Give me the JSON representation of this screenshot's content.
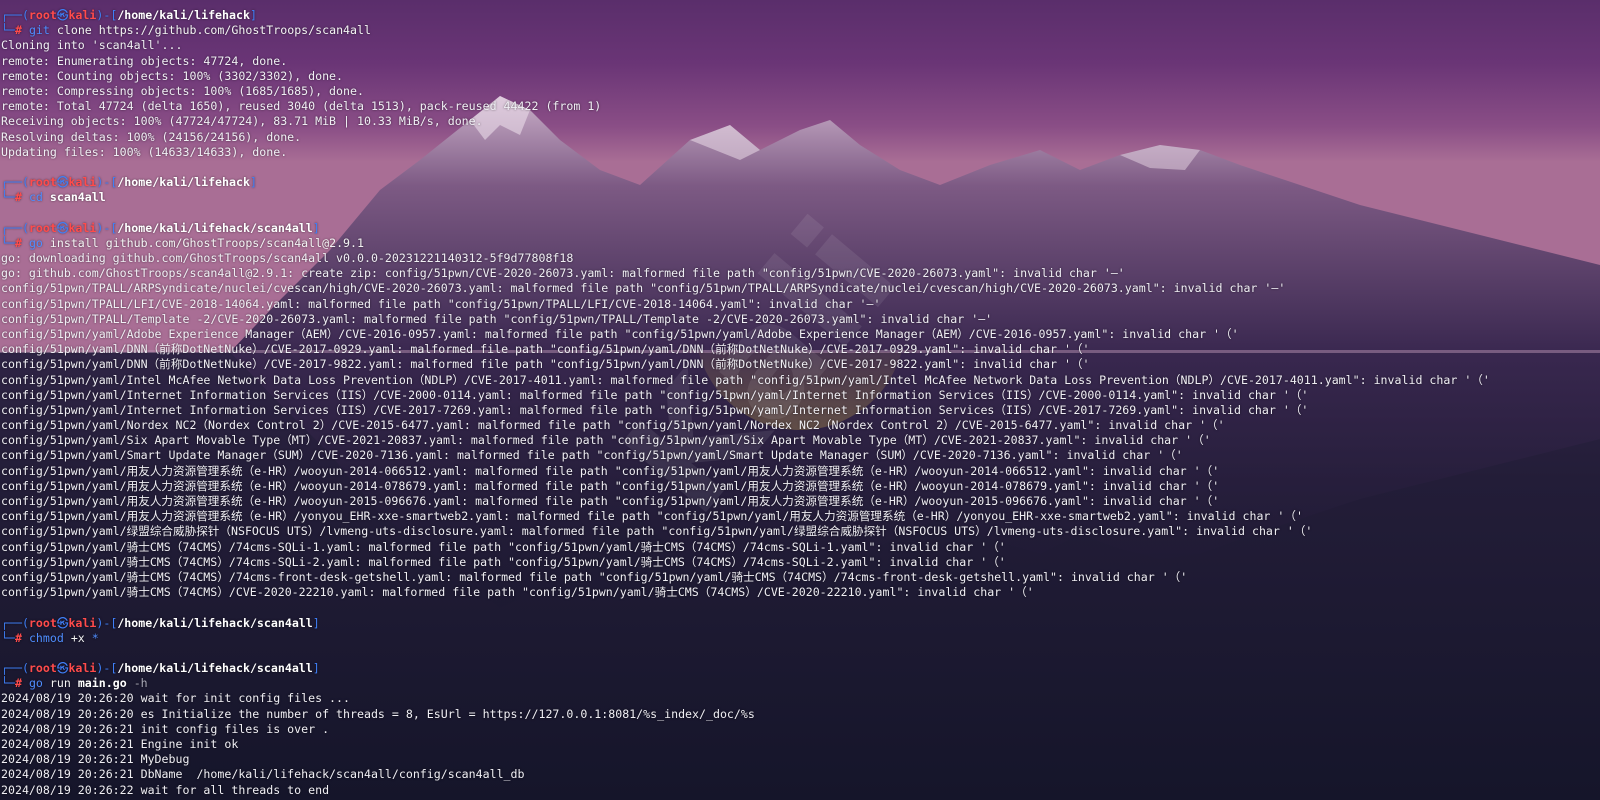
{
  "colors": {
    "prompt_frame": "#3f7ff7",
    "prompt_user": "#ff4b4b",
    "command": "#4f8dff",
    "output": "#f0eff4",
    "sky_top": "#5b2f6b",
    "sky_bottom": "#a56a8f",
    "sun": "#e8c64a",
    "water": "#1e1a33"
  },
  "wallpaper": {
    "watermark": "Kali"
  },
  "terminal": {
    "blocks": [
      {
        "prompt": {
          "frame_top": "┌──(",
          "user": "root",
          "sep": "㉿",
          "host": "kali",
          "mid": ")-[",
          "path": "/home/kali/lifehack",
          "end": "]",
          "frame_bot": "└─",
          "hash": "#"
        },
        "command": {
          "name": "git",
          "args": "clone https://github.com/GhostTroops/scan4all",
          "args_style": "arg"
        },
        "output": [
          "Cloning into 'scan4all'...",
          "remote: Enumerating objects: 47724, done.",
          "remote: Counting objects: 100% (3302/3302), done.",
          "remote: Compressing objects: 100% (1685/1685), done.",
          "remote: Total 47724 (delta 1650), reused 3040 (delta 1513), pack-reused 44422 (from 1)",
          "Receiving objects: 100% (47724/47724), 83.71 MiB | 10.33 MiB/s, done.",
          "Resolving deltas: 100% (24156/24156), done.",
          "Updating files: 100% (14633/14633), done."
        ]
      },
      {
        "prompt": {
          "frame_top": "┌──(",
          "user": "root",
          "sep": "㉿",
          "host": "kali",
          "mid": ")-[",
          "path": "/home/kali/lifehack",
          "end": "]",
          "frame_bot": "└─",
          "hash": "#"
        },
        "command": {
          "name": "cd",
          "args": "scan4all",
          "args_style": "argb"
        },
        "output": []
      },
      {
        "prompt": {
          "frame_top": "┌──(",
          "user": "root",
          "sep": "㉿",
          "host": "kali",
          "mid": ")-[",
          "path": "/home/kali/lifehack/scan4all",
          "end": "]",
          "frame_bot": "└─",
          "hash": "#"
        },
        "command": {
          "name": "go",
          "args": "install github.com/GhostTroops/scan4all@2.9.1",
          "args_style": "arg"
        },
        "output": [
          "go: downloading github.com/GhostTroops/scan4all v0.0.0-20231221140312-5f9d77808f18",
          "go: github.com/GhostTroops/scan4all@2.9.1: create zip: config/51pwn/CVE-2020-26073.yaml: malformed file path \"config/51pwn/CVE-2020-26073.yaml\": invalid char '—'",
          "config/51pwn/TPALL/ARPSyndicate/nuclei/cvescan/high/CVE-2020-26073.yaml: malformed file path \"config/51pwn/TPALL/ARPSyndicate/nuclei/cvescan/high/CVE-2020-26073.yaml\": invalid char '—'",
          "config/51pwn/TPALL/LFI/CVE-2018-14064.yaml: malformed file path \"config/51pwn/TPALL/LFI/CVE-2018-14064.yaml\": invalid char '—'",
          "config/51pwn/TPALL/Template -2/CVE-2020-26073.yaml: malformed file path \"config/51pwn/TPALL/Template -2/CVE-2020-26073.yaml\": invalid char '—'",
          "config/51pwn/yaml/Adobe Experience Manager（AEM）/CVE-2016-0957.yaml: malformed file path \"config/51pwn/yaml/Adobe Experience Manager（AEM）/CVE-2016-0957.yaml\": invalid char '（'",
          "config/51pwn/yaml/DNN（前称DotNetNuke）/CVE-2017-0929.yaml: malformed file path \"config/51pwn/yaml/DNN（前称DotNetNuke）/CVE-2017-0929.yaml\": invalid char '（'",
          "config/51pwn/yaml/DNN（前称DotNetNuke）/CVE-2017-9822.yaml: malformed file path \"config/51pwn/yaml/DNN（前称DotNetNuke）/CVE-2017-9822.yaml\": invalid char '（'",
          "config/51pwn/yaml/Intel McAfee Network Data Loss Prevention（NDLP）/CVE-2017-4011.yaml: malformed file path \"config/51pwn/yaml/Intel McAfee Network Data Loss Prevention（NDLP）/CVE-2017-4011.yaml\": invalid char '（'",
          "config/51pwn/yaml/Internet Information Services（IIS）/CVE-2000-0114.yaml: malformed file path \"config/51pwn/yaml/Internet Information Services（IIS）/CVE-2000-0114.yaml\": invalid char '（'",
          "config/51pwn/yaml/Internet Information Services（IIS）/CVE-2017-7269.yaml: malformed file path \"config/51pwn/yaml/Internet Information Services（IIS）/CVE-2017-7269.yaml\": invalid char '（'",
          "config/51pwn/yaml/Nordex NC2（Nordex Control 2）/CVE-2015-6477.yaml: malformed file path \"config/51pwn/yaml/Nordex NC2（Nordex Control 2）/CVE-2015-6477.yaml\": invalid char '（'",
          "config/51pwn/yaml/Six Apart Movable Type（MT）/CVE-2021-20837.yaml: malformed file path \"config/51pwn/yaml/Six Apart Movable Type（MT）/CVE-2021-20837.yaml\": invalid char '（'",
          "config/51pwn/yaml/Smart Update Manager（SUM）/CVE-2020-7136.yaml: malformed file path \"config/51pwn/yaml/Smart Update Manager（SUM）/CVE-2020-7136.yaml\": invalid char '（'",
          "config/51pwn/yaml/用友人力资源管理系统（e-HR）/wooyun-2014-066512.yaml: malformed file path \"config/51pwn/yaml/用友人力资源管理系统（e-HR）/wooyun-2014-066512.yaml\": invalid char '（'",
          "config/51pwn/yaml/用友人力资源管理系统（e-HR）/wooyun-2014-078679.yaml: malformed file path \"config/51pwn/yaml/用友人力资源管理系统（e-HR）/wooyun-2014-078679.yaml\": invalid char '（'",
          "config/51pwn/yaml/用友人力资源管理系统（e-HR）/wooyun-2015-096676.yaml: malformed file path \"config/51pwn/yaml/用友人力资源管理系统（e-HR）/wooyun-2015-096676.yaml\": invalid char '（'",
          "config/51pwn/yaml/用友人力资源管理系统（e-HR）/yonyou_EHR-xxe-smartweb2.yaml: malformed file path \"config/51pwn/yaml/用友人力资源管理系统（e-HR）/yonyou_EHR-xxe-smartweb2.yaml\": invalid char '（'",
          "config/51pwn/yaml/绿盟综合威胁探针（NSFOCUS UTS）/lvmeng-uts-disclosure.yaml: malformed file path \"config/51pwn/yaml/绿盟综合威胁探针（NSFOCUS UTS）/lvmeng-uts-disclosure.yaml\": invalid char '（'",
          "config/51pwn/yaml/骑士CMS（74CMS）/74cms-SQLi-1.yaml: malformed file path \"config/51pwn/yaml/骑士CMS（74CMS）/74cms-SQLi-1.yaml\": invalid char '（'",
          "config/51pwn/yaml/骑士CMS（74CMS）/74cms-SQLi-2.yaml: malformed file path \"config/51pwn/yaml/骑士CMS（74CMS）/74cms-SQLi-2.yaml\": invalid char '（'",
          "config/51pwn/yaml/骑士CMS（74CMS）/74cms-front-desk-getshell.yaml: malformed file path \"config/51pwn/yaml/骑士CMS（74CMS）/74cms-front-desk-getshell.yaml\": invalid char '（'",
          "config/51pwn/yaml/骑士CMS（74CMS）/CVE-2020-22210.yaml: malformed file path \"config/51pwn/yaml/骑士CMS（74CMS）/CVE-2020-22210.yaml\": invalid char '（'"
        ]
      },
      {
        "prompt": {
          "frame_top": "┌──(",
          "user": "root",
          "sep": "㉿",
          "host": "kali",
          "mid": ")-[",
          "path": "/home/kali/lifehack/scan4all",
          "end": "]",
          "frame_bot": "└─",
          "hash": "#"
        },
        "command": {
          "name": "chmod",
          "args": "+x",
          "args_style": "arg",
          "extra": "*"
        },
        "output": []
      },
      {
        "prompt": {
          "frame_top": "┌──(",
          "user": "root",
          "sep": "㉿",
          "host": "kali",
          "mid": ")-[",
          "path": "/home/kali/lifehack/scan4all",
          "end": "]",
          "frame_bot": "└─",
          "hash": "#"
        },
        "command": {
          "name": "go",
          "args": "run",
          "args_style": "arg",
          "file": "main.go",
          "flag": "-h"
        },
        "output": [
          "2024/08/19 20:26:20 wait for init config files ...",
          "2024/08/19 20:26:20 es Initialize the number of threads = 8, EsUrl = https://127.0.0.1:8081/%s_index/_doc/%s",
          "2024/08/19 20:26:21 init config files is over .",
          "2024/08/19 20:26:21 Engine init ok",
          "2024/08/19 20:26:21 MyDebug",
          "2024/08/19 20:26:21 DbName  /home/kali/lifehack/scan4all/config/scan4all_db",
          "2024/08/19 20:26:22 wait for all threads to end"
        ]
      }
    ]
  }
}
